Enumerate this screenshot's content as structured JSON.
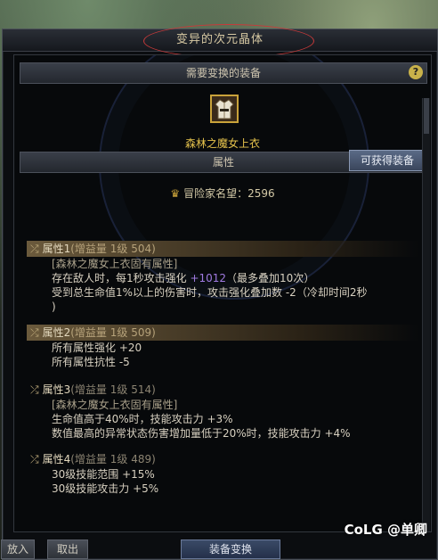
{
  "window": {
    "title": "变异的次元晶体"
  },
  "panel": {
    "header": "需要变换的装备",
    "help": "?",
    "item_name": "森林之魔女上衣",
    "attr_header": "属性",
    "obtain_button": "可获得装备",
    "fame": "冒险家名望：2596"
  },
  "attributes": [
    {
      "title": "属性1",
      "sub": "(增益量 1级 504)",
      "lines": [
        {
          "text": "[森林之魔女上衣固有属性]",
          "bracket": true
        },
        {
          "text": "存在敌人时，每1秒攻击强化 ",
          "purple": "+1012",
          "tail": "（最多叠加10次）"
        },
        {
          "text": "受到总生命值1%以上的伤害时，攻击强化叠加数 -2（冷却时间2秒"
        },
        {
          "text": ")"
        }
      ]
    },
    {
      "title": "属性2",
      "sub": "(增益量 1级 509)",
      "lines": [
        {
          "text": "所有属性强化 +20"
        },
        {
          "text": "所有属性抗性 -5"
        }
      ]
    },
    {
      "title": "属性3",
      "sub": "(增益量 1级 514)",
      "lines": [
        {
          "text": "[森林之魔女上衣固有属性]",
          "bracket": true
        },
        {
          "text": "生命值高于40%时，技能攻击力 +3%"
        },
        {
          "text": "数值最高的异常状态伤害增加量低于20%时，技能攻击力 +4%"
        }
      ]
    },
    {
      "title": "属性4",
      "sub": "(增益量 1级 489)",
      "lines": [
        {
          "text": "30级技能范围 +15%"
        },
        {
          "text": "30级技能攻击力 +5%"
        }
      ]
    }
  ],
  "bottom": {
    "left1": "放入",
    "left2": "取出",
    "confirm": "装备变换"
  },
  "watermark": "CoLG @单卿"
}
